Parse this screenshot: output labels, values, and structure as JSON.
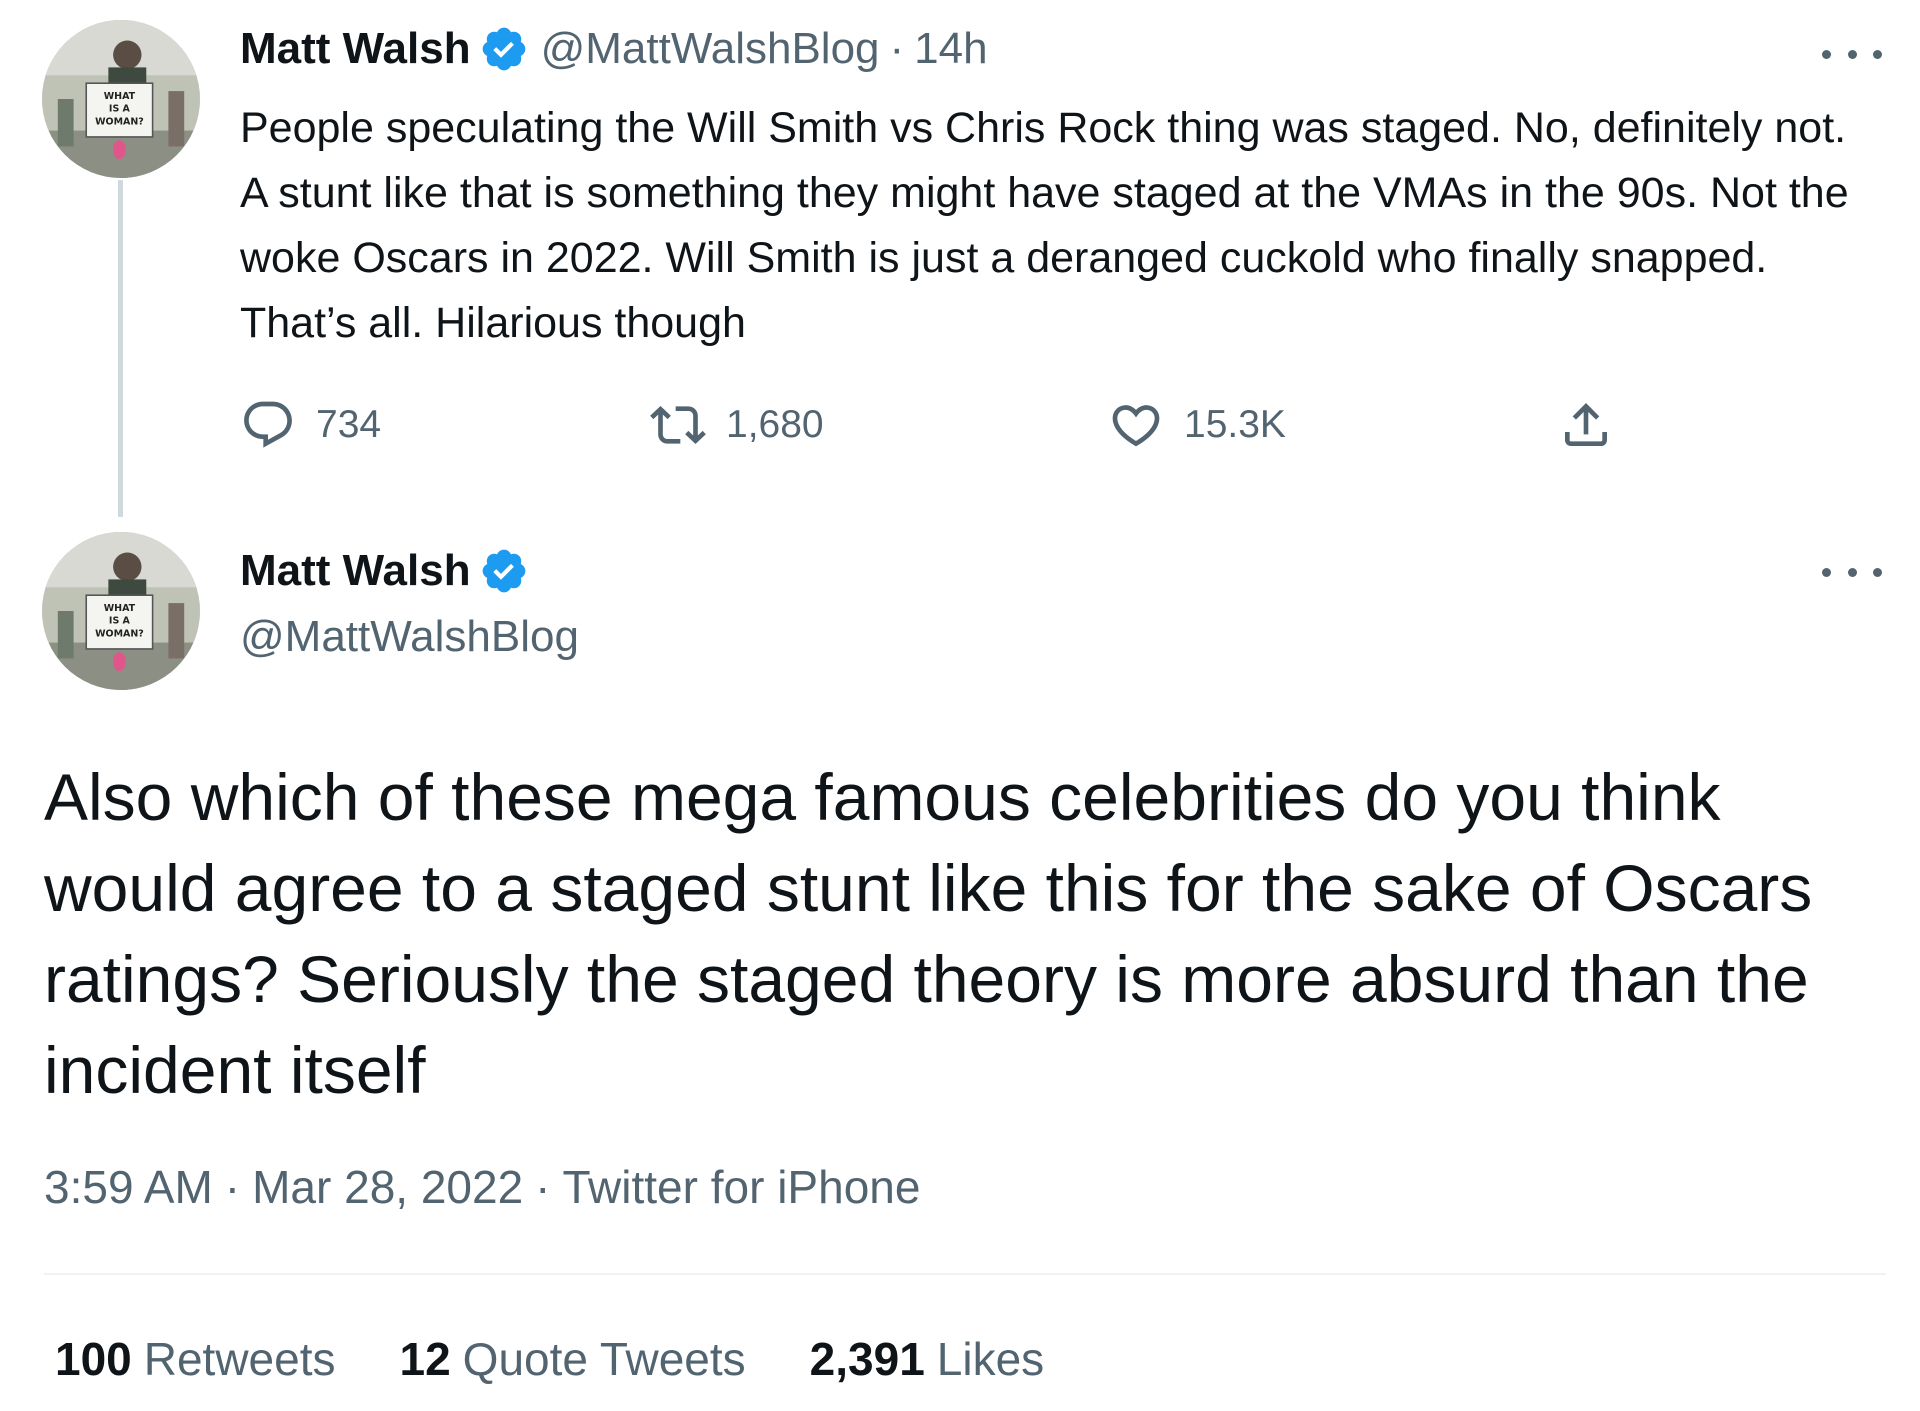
{
  "colors": {
    "text_primary": "#0f1419",
    "text_secondary": "#536471",
    "verified_blue": "#1d9bf0",
    "thread_line": "#cfd9de",
    "divider": "#eff3f4"
  },
  "parent_tweet": {
    "display_name": "Matt Walsh",
    "verified_icon": "verified-badge-icon",
    "handle": "@MattWalshBlog",
    "separator": "·",
    "time_ago": "14h",
    "text": "People speculating the Will Smith vs Chris Rock thing was staged. No, definitely not. A stunt like that is something they might have staged at the VMAs in the 90s. Not the woke Oscars in 2022. Will Smith is just a deranged cuckold who finally snapped. That’s all. Hilarious though",
    "actions": {
      "reply": {
        "icon": "reply-icon",
        "count": "734"
      },
      "retweet": {
        "icon": "retweet-icon",
        "count": "1,680"
      },
      "like": {
        "icon": "heart-icon",
        "count": "15.3K"
      },
      "share": {
        "icon": "share-icon"
      }
    },
    "avatar_sign_text": "WHAT IS A WOMAN?"
  },
  "main_tweet": {
    "display_name": "Matt Walsh",
    "handle": "@MattWalshBlog",
    "text": "Also which of these mega famous celebrities do you think would agree to a staged stunt like this for the sake of Oscars ratings? Seriously the staged theory is more absurd than the incident itself",
    "time": "3:59 AM",
    "separator": "·",
    "date": "Mar 28, 2022",
    "source": "Twitter for iPhone",
    "stats": [
      {
        "num": "100",
        "label": "Retweets"
      },
      {
        "num": "12",
        "label": "Quote Tweets"
      },
      {
        "num": "2,391",
        "label": "Likes"
      }
    ]
  }
}
